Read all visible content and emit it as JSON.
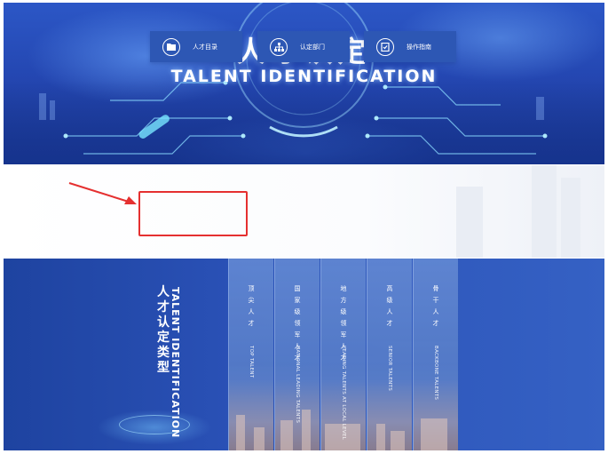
{
  "hero": {
    "title": "人才认定",
    "subtitle": "TALENT IDENTIFICATION"
  },
  "nav": [
    {
      "label": "人才目录",
      "icon": "folder-icon"
    },
    {
      "label": "认定部门",
      "icon": "org-chart-icon"
    },
    {
      "label": "操作指南",
      "icon": "guide-book-icon"
    }
  ],
  "types": {
    "title": "人才认定类型",
    "title_en": "TALENT IDENTIFICATION",
    "columns": [
      {
        "cn": "顶尖人才",
        "en": "TOP TALENT"
      },
      {
        "cn": "国家级领军人才",
        "en": "NATIONAL LEADING TALENTS"
      },
      {
        "cn": "地方级领军人才",
        "en": "LEADING TALENTS AT LOCAL LEVEL"
      },
      {
        "cn": "高级人才",
        "en": "SENIOR TALENTS"
      },
      {
        "cn": "骨干人才",
        "en": "BACKBONE TALENTS"
      }
    ]
  },
  "colors": {
    "accent_blue": "#2d57b4",
    "highlight_red": "#e53030"
  }
}
